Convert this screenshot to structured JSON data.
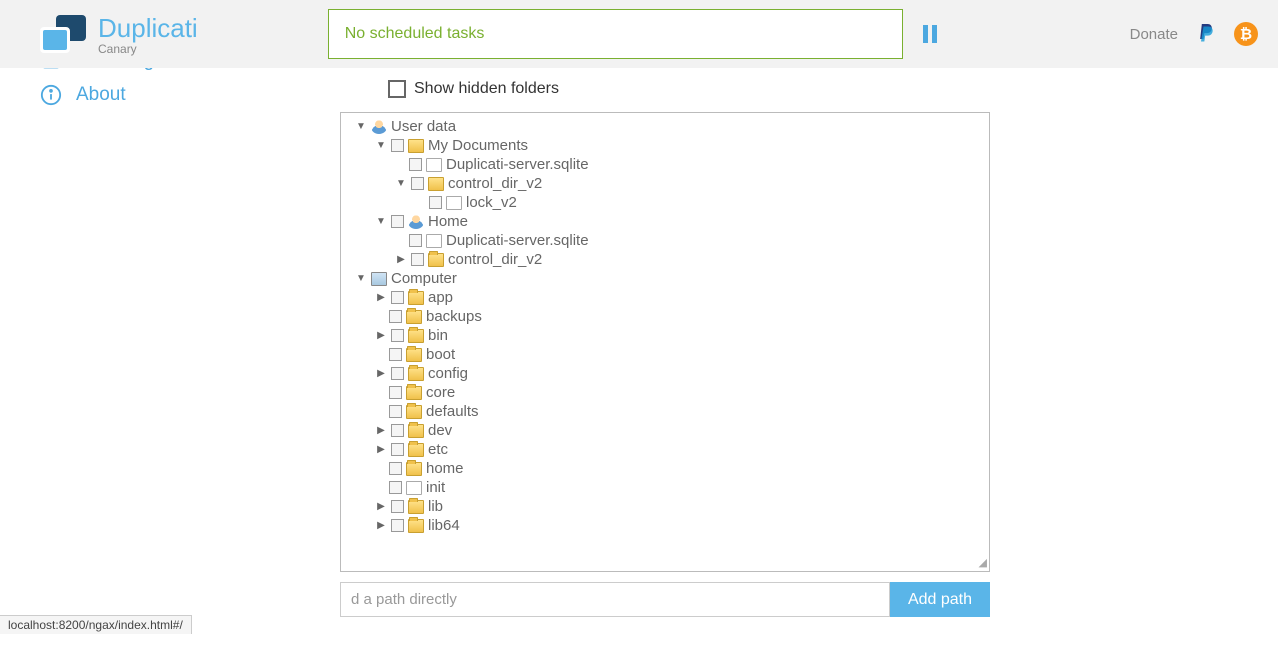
{
  "header": {
    "app_name": "Duplicati",
    "subtitle": "Canary",
    "status": "No scheduled tasks",
    "donate": "Donate"
  },
  "nav": {
    "showlog": "Show log",
    "about": "About"
  },
  "main": {
    "hidden_label": "Show hidden folders",
    "path_placeholder": "d a path directly",
    "add_path": "Add path"
  },
  "tree": {
    "user_data": "User data",
    "my_documents": "My Documents",
    "dup_sqlite": "Duplicati-server.sqlite",
    "control_dir_v2": "control_dir_v2",
    "lock_v2": "lock_v2",
    "home_user": "Home",
    "computer": "Computer",
    "app": "app",
    "backups": "backups",
    "bin": "bin",
    "boot": "boot",
    "config": "config",
    "core": "core",
    "defaults": "defaults",
    "dev": "dev",
    "etc": "etc",
    "home": "home",
    "init": "init",
    "lib": "lib",
    "lib64": "lib64"
  },
  "status_bar": "localhost:8200/ngax/index.html#/"
}
